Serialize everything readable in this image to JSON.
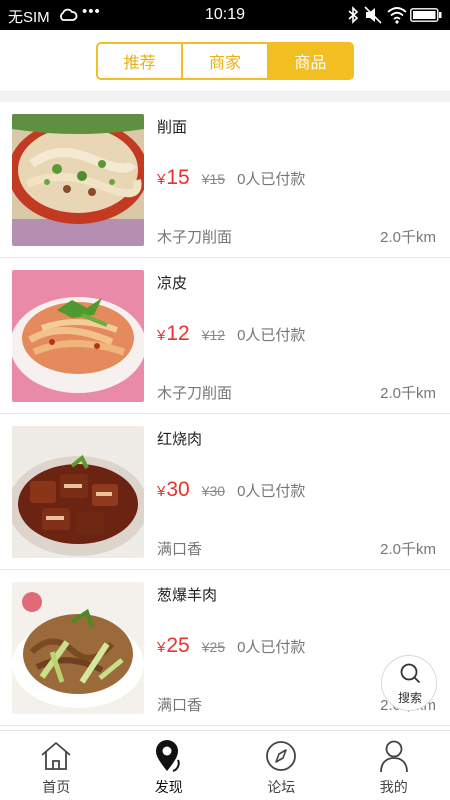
{
  "status_bar": {
    "carrier": "无SIM",
    "dots": "•••",
    "time": "10:19"
  },
  "tabs": [
    {
      "label": "推荐",
      "active": false
    },
    {
      "label": "商家",
      "active": false
    },
    {
      "label": "商品",
      "active": true
    }
  ],
  "products": [
    {
      "name": "削面",
      "currency": "¥",
      "price": "15",
      "old_price": "¥15",
      "paid": "0人已付款",
      "shop": "木子刀削面",
      "distance": "2.0千km",
      "image": "noodle-soup-photo"
    },
    {
      "name": "凉皮",
      "currency": "¥",
      "price": "12",
      "old_price": "¥12",
      "paid": "0人已付款",
      "shop": "木子刀削面",
      "distance": "2.0千km",
      "image": "cold-noodle-photo"
    },
    {
      "name": "红烧肉",
      "currency": "¥",
      "price": "30",
      "old_price": "¥30",
      "paid": "0人已付款",
      "shop": "满口香",
      "distance": "2.0千km",
      "image": "braised-pork-photo"
    },
    {
      "name": "葱爆羊肉",
      "currency": "¥",
      "price": "25",
      "old_price": "¥25",
      "paid": "0人已付款",
      "shop": "满口香",
      "distance": "2.0千km",
      "image": "scallion-lamb-photo"
    }
  ],
  "search_fab": {
    "label": "搜索",
    "icon": "search-icon"
  },
  "bottom_nav": [
    {
      "label": "首页",
      "icon": "home-icon",
      "active": false
    },
    {
      "label": "发现",
      "icon": "location-pin-icon",
      "active": true
    },
    {
      "label": "论坛",
      "icon": "compass-icon",
      "active": false
    },
    {
      "label": "我的",
      "icon": "person-icon",
      "active": false
    }
  ],
  "colors": {
    "accent": "#f2be22",
    "price": "#e6342d",
    "status_bar": "#000000"
  }
}
